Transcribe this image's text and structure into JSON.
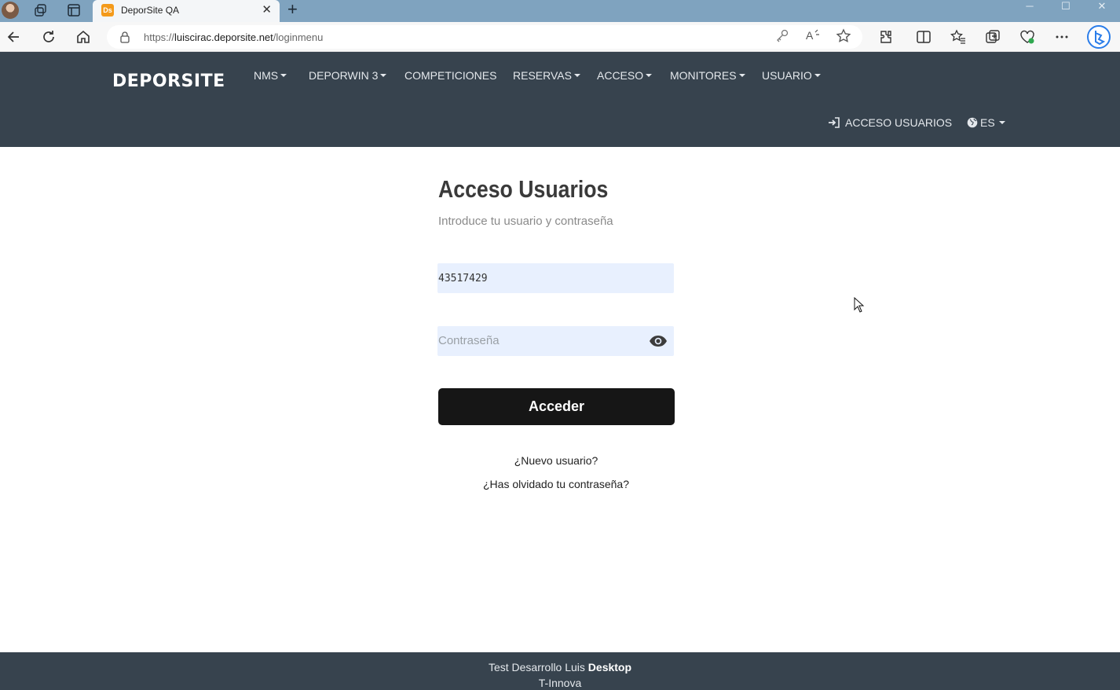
{
  "browser": {
    "tab_title": "DeporSite QA",
    "tab_favicon_text": "Ds",
    "url_prefix": "https://",
    "url_host": "luiscirac.deporsite.net",
    "url_path": "/loginmenu",
    "accent_color": "#7fa3bf"
  },
  "navbar": {
    "brand": "DEPORSITE",
    "items": [
      {
        "label": "NMS"
      },
      {
        "label": "DEPORWIN 3"
      },
      {
        "label": "COMPETICIONES"
      },
      {
        "label": "RESERVAS"
      },
      {
        "label": "ACCESO"
      },
      {
        "label": "MONITORES"
      },
      {
        "label": "USUARIO"
      }
    ],
    "login_label": "ACCESO USUARIOS",
    "language": "ES",
    "background_color": "#37434e"
  },
  "login": {
    "title": "Acceso Usuarios",
    "subtitle": "Introduce tu usuario y contraseña",
    "username_value": "43517429",
    "password_placeholder": "Contraseña",
    "submit_label": "Acceder",
    "new_user_link": "¿Nuevo usuario?",
    "forgot_password_link": "¿Has olvidado tu contraseña?"
  },
  "footer": {
    "line1_prefix": "Test Desarrollo Luis ",
    "line1_bold": "Desktop",
    "line2": "T-Innova"
  }
}
